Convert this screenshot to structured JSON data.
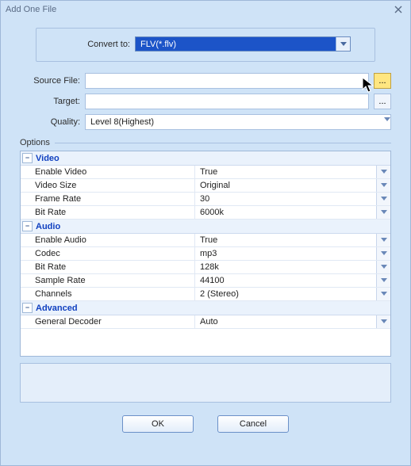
{
  "window": {
    "title": "Add One File"
  },
  "convert": {
    "label": "Convert to:",
    "value": "FLV(*.flv)"
  },
  "source": {
    "label": "Source File:",
    "value": "",
    "browse": "..."
  },
  "target": {
    "label": "Target:",
    "value": "",
    "browse": "..."
  },
  "quality": {
    "label": "Quality:",
    "value": "Level 8(Highest)"
  },
  "options_label": "Options",
  "sections": {
    "video": {
      "title": "Video",
      "props": [
        {
          "name": "Enable Video",
          "value": "True"
        },
        {
          "name": "Video Size",
          "value": "Original"
        },
        {
          "name": "Frame Rate",
          "value": "30"
        },
        {
          "name": "Bit Rate",
          "value": "6000k"
        }
      ]
    },
    "audio": {
      "title": "Audio",
      "props": [
        {
          "name": "Enable Audio",
          "value": "True"
        },
        {
          "name": "Codec",
          "value": "mp3"
        },
        {
          "name": "Bit Rate",
          "value": "128k"
        },
        {
          "name": "Sample Rate",
          "value": "44100"
        },
        {
          "name": "Channels",
          "value": "2 (Stereo)"
        }
      ]
    },
    "advanced": {
      "title": "Advanced",
      "props": [
        {
          "name": "General Decoder",
          "value": "Auto"
        }
      ]
    }
  },
  "buttons": {
    "ok": "OK",
    "cancel": "Cancel"
  },
  "expand_glyph": "−"
}
